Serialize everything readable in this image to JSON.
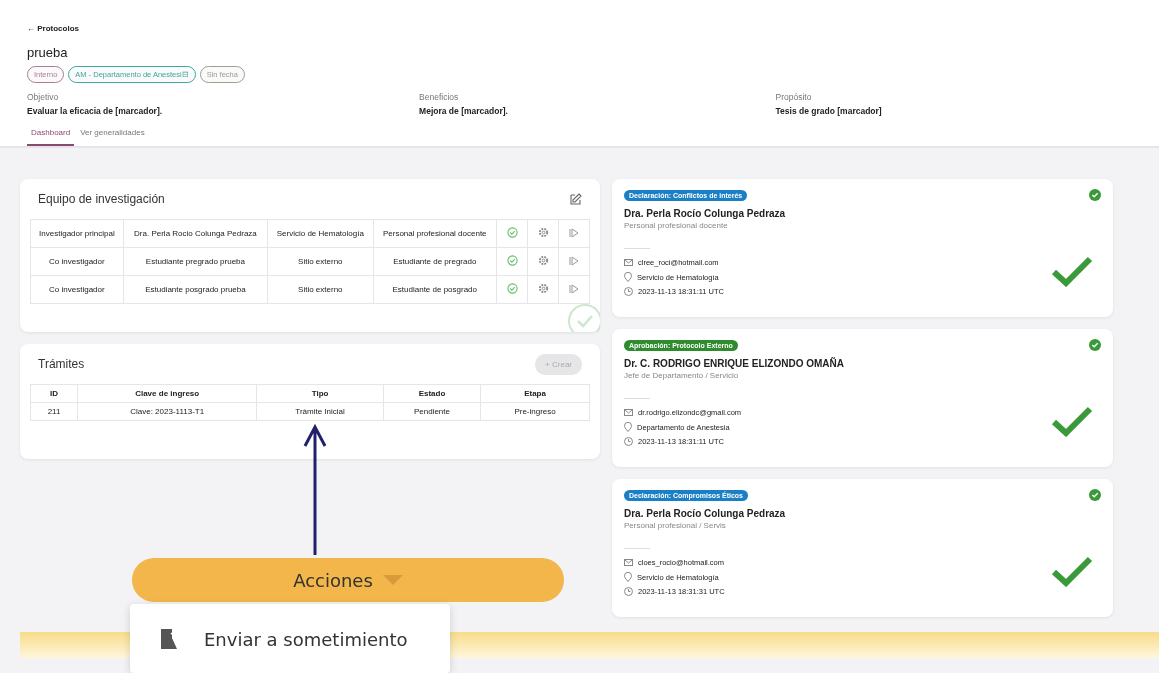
{
  "back_link": "← Protocolos",
  "title": "prueba",
  "tags": [
    {
      "label": "Interno",
      "color": "#b07a95"
    },
    {
      "label": "AM - Departamento de Anestesi⊟",
      "color": "#3aa7a0"
    },
    {
      "label": "Sin fecha",
      "color": "#9aa08e"
    }
  ],
  "fields": [
    {
      "label": "Objetivo",
      "value": "Evaluar la eficacia de [marcador]."
    },
    {
      "label": "Beneficios",
      "value": "Mejora de [marcador]."
    },
    {
      "label": "Propósito",
      "value": "Tesis de grado [marcador]"
    }
  ],
  "tabs": [
    {
      "label": "Dashboard",
      "selected": true
    },
    {
      "label": "Ver generalidades",
      "selected": false
    }
  ],
  "team": {
    "title": "Equipo de investigación",
    "rows": [
      [
        "Investigador principal",
        "Dra. Perla Rocio Colunga Pedraza",
        "Servicio de Hematología",
        "Personal profesional docente"
      ],
      [
        "Co investigador",
        "Estudiante pregrado prueba",
        "Sitio externo",
        "Estudiante de pregrado"
      ],
      [
        "Co investigador",
        "Estudiante posgrado prueba",
        "Sitio externo",
        "Estudiante de posgrado"
      ]
    ]
  },
  "tramites": {
    "title": "Trámites",
    "create_button": "+ Crear",
    "columns": [
      "ID",
      "Clave de ingreso",
      "Tipo",
      "Estado",
      "Etapa"
    ],
    "rows": [
      [
        "211",
        "Clave: 2023-1113-T1",
        "Trámite Inicial",
        "Pendiente",
        "Pre-ingreso"
      ]
    ]
  },
  "cards": [
    {
      "badge": "Declaración: Conflictos de interés",
      "color": "#1a7fc4",
      "name": "Dra. Perla Rocío Colunga Pedraza",
      "role": "Personal profesional docente",
      "email": "clree_roci@hotmail.com",
      "place": "Servicio de Hematología",
      "time": "2023-11-13 18:31:11 UTC"
    },
    {
      "badge": "Aprobación: Protocolo Externo",
      "color": "#2e8b2e",
      "name": "Dr. C. RODRIGO ENRIQUE ELIZONDO OMAÑA",
      "role": "Jefe de Departamento / Servicio",
      "email": "dr.rodrigo.elizondc@gmail.com",
      "place": "Departamento de Anestesia",
      "time": "2023-11-13 18:31:11 UTC"
    },
    {
      "badge": "Declaración: Compromisos Éticos",
      "color": "#1a7fc4",
      "name": "Dra. Perla Rocío Colunga Pedraza",
      "role": "Personal profesional / Servis",
      "email": "cloes_rocio@hotmail.com",
      "place": "Servicio de Hematología",
      "time": "2023-11-13 18:31:31 UTC"
    }
  ],
  "actions": {
    "button": "Acciones",
    "menu": [
      "Enviar a sometimiento"
    ]
  }
}
